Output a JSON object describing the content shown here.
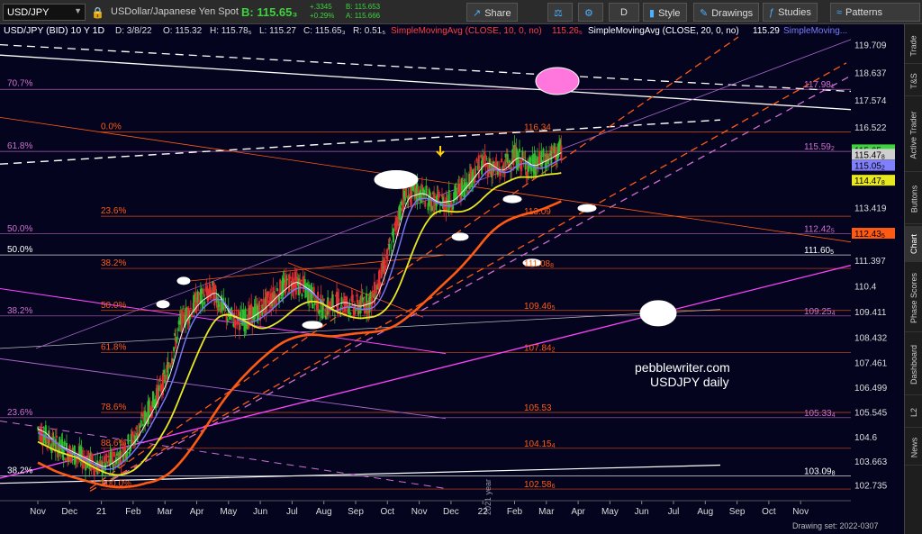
{
  "toolbar": {
    "symbol": "USD/JPY",
    "description": "USDollar/Japanese Yen Spot",
    "bid_label": "B: 115.65₃",
    "change": "+.3345",
    "change_pct": "+0.29%",
    "bid_small": "B: 115.653",
    "ask_small": "A: 115.666",
    "share": "Share",
    "period": "D",
    "style": "Style",
    "drawings": "Drawings",
    "studies": "Studies",
    "patterns": "Patterns"
  },
  "header": {
    "title": "USD/JPY (BID) 10 Y 1D",
    "date": "D: 3/8/22",
    "open": "O: 115.32",
    "high": "H: 115.78₅",
    "low": "L: 115.27",
    "close": "C: 115.65₃",
    "range": "R: 0.51₅",
    "sma10": "SimpleMovingAvg (CLOSE, 10, 0, no)",
    "sma10_val": "115.26₅",
    "sma20": "SimpleMovingAvg (CLOSE, 20, 0, no)",
    "sma20_val": "115.29",
    "sma_more": "SimpleMoving..."
  },
  "sidebar": {
    "tabs": [
      "Trade",
      "T&S",
      "Active Trader",
      "Buttons",
      "Chart",
      "Phase Scores",
      "Dashboard",
      "L2",
      "News"
    ]
  },
  "footer": {
    "drawing_set": "Drawing set: 2022-0307"
  },
  "watermark": {
    "site": "pebblewriter.com",
    "caption": "USDJPY daily"
  },
  "colors": {
    "background": "#04041e",
    "candles_up": "#2fbf2f",
    "candles_down": "#e03030",
    "sma_white": "#ffffff",
    "sma_blue": "#7a7aff",
    "sma_yellow": "#e8e820",
    "sma_orange": "#ff5a14",
    "fib_violet": "#d070d0",
    "fib_orange": "#ff5a14"
  },
  "chart_data": {
    "type": "candlestick",
    "title": "USD/JPY (BID) 10 Y 1D",
    "ylim": [
      102.2,
      120.0
    ],
    "y_ticks": [
      "119.709",
      "118.637",
      "117.574",
      "116.522",
      "115.47",
      "114.432",
      "113.419",
      "112.402",
      "111.397",
      "110.4",
      "109.411",
      "108.432",
      "107.461",
      "106.499",
      "105.545",
      "104.6",
      "103.663",
      "102.735"
    ],
    "x_ticks": [
      "Nov",
      "Dec",
      "21",
      "Feb",
      "Mar",
      "Apr",
      "May",
      "Jun",
      "Jul",
      "Aug",
      "Sep",
      "Oct",
      "Nov",
      "Dec",
      "22",
      "Feb",
      "Mar",
      "Apr",
      "May",
      "Jun",
      "Jul",
      "Aug",
      "Sep",
      "Oct",
      "Nov"
    ],
    "x_tick_index": [
      0,
      1,
      2,
      3,
      4,
      5,
      6,
      7,
      8,
      9,
      10,
      11,
      12,
      13,
      14,
      15,
      16,
      17,
      18,
      19,
      20,
      21,
      22,
      23,
      24
    ],
    "series": [
      {
        "x": [
          0.0,
          0.5,
          1.0,
          1.5,
          2.0,
          2.5,
          3.0,
          3.5,
          4.0,
          4.5,
          5.0,
          5.5,
          6.0,
          6.5,
          7.0,
          7.5,
          8.0,
          8.5,
          9.0,
          9.5,
          10.0,
          10.5,
          11.0,
          11.5,
          12.0,
          12.5,
          13.0,
          13.5,
          14.0,
          14.5,
          15.0,
          15.5,
          16.0,
          16.5
        ],
        "close": [
          104.9,
          104.3,
          104.0,
          103.7,
          103.4,
          103.8,
          104.5,
          105.6,
          106.8,
          109.0,
          109.8,
          110.2,
          109.2,
          109.1,
          109.5,
          110.1,
          110.6,
          110.2,
          109.5,
          109.8,
          109.6,
          109.8,
          111.5,
          113.8,
          114.0,
          113.6,
          113.7,
          114.4,
          115.2,
          114.8,
          115.4,
          115.0,
          115.3,
          115.65
        ]
      },
      {
        "name": "SimpleMovingAvg (CLOSE, 10, 0, no)",
        "last": 115.265
      },
      {
        "name": "SimpleMovingAvg (CLOSE, 20, 0, no)",
        "last": 115.29
      }
    ],
    "price_labels": [
      {
        "text": "117.98",
        "sub": "1",
        "value": 117.98,
        "color": "#d070d0"
      },
      {
        "text": "116.34",
        "sub": "",
        "value": 116.34,
        "color": "#ff5a14"
      },
      {
        "text": "115.59",
        "sub": "2",
        "value": 115.59,
        "color": "#d070d0"
      },
      {
        "text": "113.09",
        "sub": "",
        "value": 113.09,
        "color": "#ff5a14"
      },
      {
        "text": "112.42",
        "sub": "5",
        "value": 112.42,
        "color": "#d070d0"
      },
      {
        "text": "111.60",
        "sub": "5",
        "value": 111.6,
        "color": "#ffffff"
      },
      {
        "text": "111.08",
        "sub": "8",
        "value": 111.08,
        "color": "#ff5a14"
      },
      {
        "text": "109.46",
        "sub": "5",
        "value": 109.46,
        "color": "#ff5a14"
      },
      {
        "text": "109.25",
        "sub": "4",
        "value": 109.25,
        "color": "#d070d0"
      },
      {
        "text": "107.84",
        "sub": "2",
        "value": 107.84,
        "color": "#ff5a14"
      },
      {
        "text": "105.53",
        "sub": "",
        "value": 105.53,
        "color": "#ff5a14"
      },
      {
        "text": "105.33",
        "sub": "4",
        "value": 105.33,
        "color": "#d070d0"
      },
      {
        "text": "104.15",
        "sub": "4",
        "value": 104.15,
        "color": "#ff5a14"
      },
      {
        "text": "103.09",
        "sub": "8",
        "value": 103.09,
        "color": "#ffffff"
      },
      {
        "text": "102.58",
        "sub": "6",
        "value": 102.58,
        "color": "#ff5a14"
      }
    ],
    "fib_labels": [
      {
        "text": "70.7%",
        "value": 118.0,
        "color": "#d070d0",
        "side": "left"
      },
      {
        "text": "61.8%",
        "value": 115.6,
        "color": "#d070d0",
        "side": "left"
      },
      {
        "text": "50.0%",
        "value": 112.4,
        "color": "#d070d0",
        "side": "left"
      },
      {
        "text": "50.0%",
        "value": 111.6,
        "color": "#ffffff",
        "side": "left"
      },
      {
        "text": "38.2%",
        "value": 109.25,
        "color": "#d070d0",
        "side": "left"
      },
      {
        "text": "23.6%",
        "value": 105.33,
        "color": "#d070d0",
        "side": "left"
      },
      {
        "text": "38.2%",
        "value": 103.09,
        "color": "#ffffff",
        "side": "left"
      },
      {
        "text": "0.0%",
        "value": 116.34,
        "color": "#ff5a14",
        "side": "mid"
      },
      {
        "text": "23.6%",
        "value": 113.09,
        "color": "#ff5a14",
        "side": "mid"
      },
      {
        "text": "38.2%",
        "value": 111.08,
        "color": "#ff5a14",
        "side": "mid"
      },
      {
        "text": "50.0%",
        "value": 109.46,
        "color": "#ff5a14",
        "side": "mid"
      },
      {
        "text": "61.8%",
        "value": 107.84,
        "color": "#ff5a14",
        "side": "mid"
      },
      {
        "text": "78.6%",
        "value": 105.53,
        "color": "#ff5a14",
        "side": "mid"
      },
      {
        "text": "88.6%",
        "value": 104.15,
        "color": "#ff5a14",
        "side": "mid"
      },
      {
        "text": "100.0%",
        "value": 102.58,
        "color": "#ff5a14",
        "side": "mid"
      }
    ],
    "axis_boxes": [
      {
        "text": "115.65",
        "sub": "3",
        "value": 115.65,
        "bg": "#3fd23f",
        "fg": "#000000"
      },
      {
        "text": "115.47",
        "sub": "8",
        "value": 115.478,
        "bg": "#cfcfcf",
        "fg": "#000000"
      },
      {
        "text": "115.05",
        "sub": "2",
        "value": 115.052,
        "bg": "#8080ff",
        "fg": "#000000"
      },
      {
        "text": "114.47",
        "sub": "8",
        "value": 114.478,
        "bg": "#e8e820",
        "fg": "#000000"
      },
      {
        "text": "112.43",
        "sub": "5",
        "value": 112.435,
        "bg": "#ff5a14",
        "fg": "#000000"
      }
    ],
    "annotation_year": "2021 year"
  }
}
